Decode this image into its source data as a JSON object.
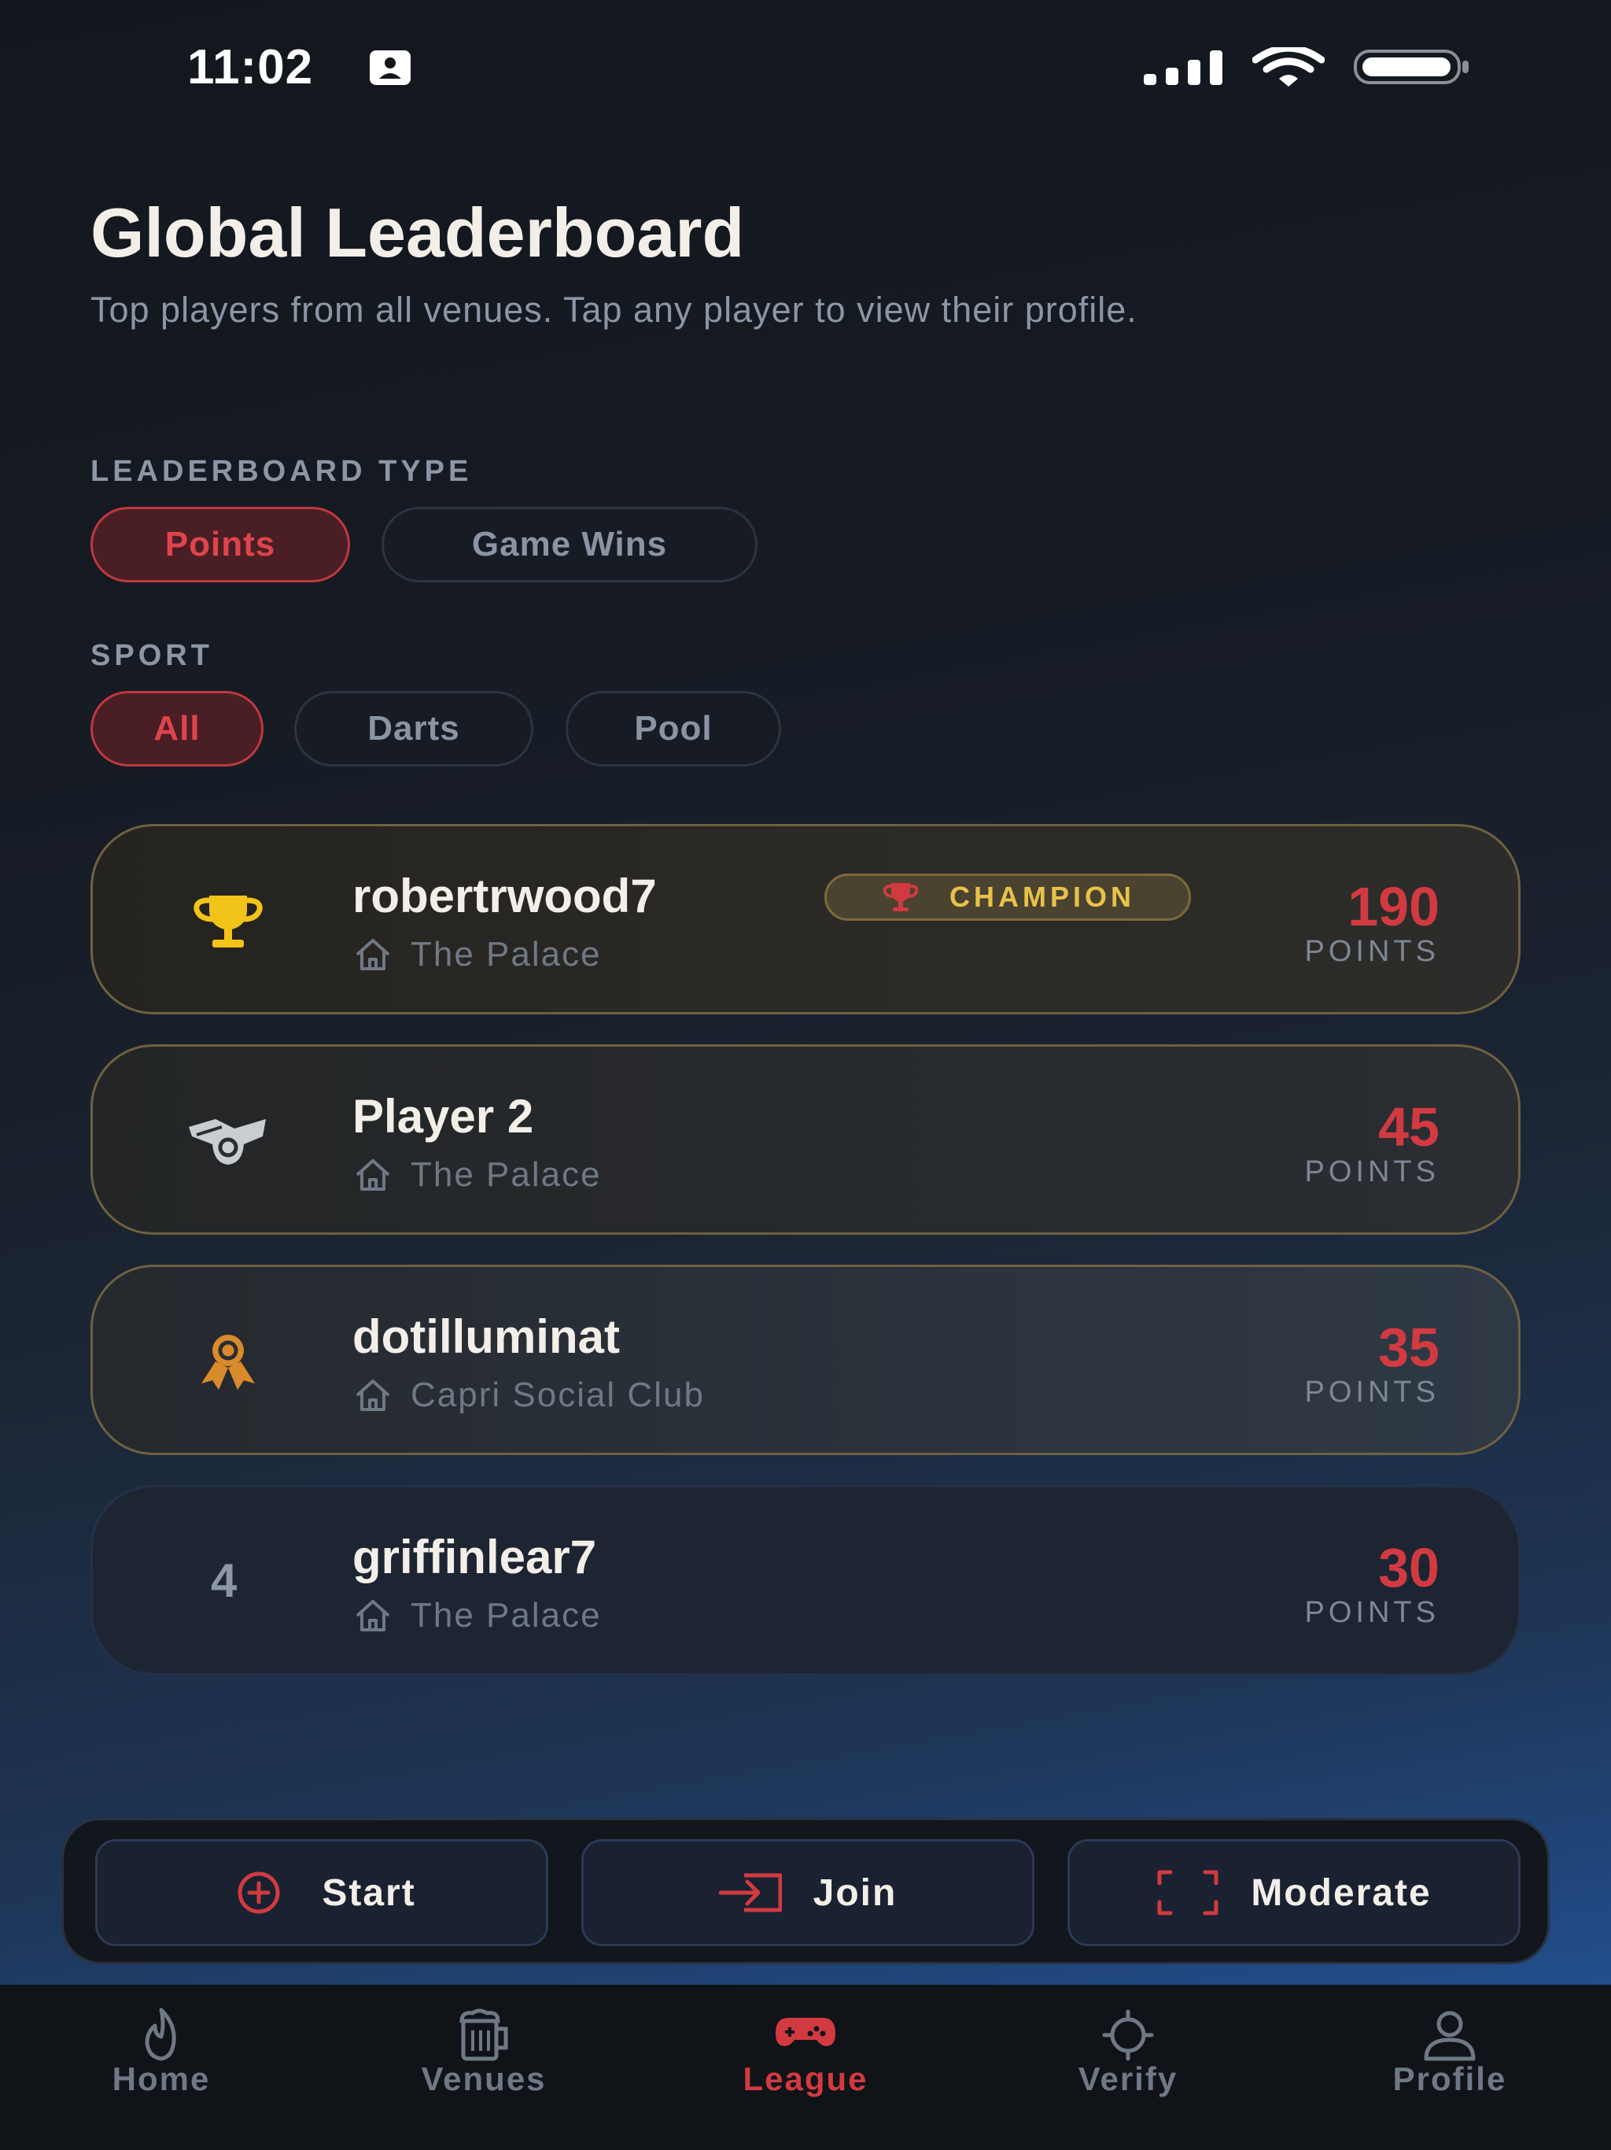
{
  "status_bar": {
    "time": "11:02"
  },
  "header": {
    "title": "Global Leaderboard",
    "subtitle": "Top players from all venues. Tap any player to view their profile."
  },
  "filters": {
    "type_label": "LEADERBOARD TYPE",
    "type_options": [
      "Points",
      "Game Wins"
    ],
    "type_selected": "Points",
    "sport_label": "SPORT",
    "sport_options": [
      "All",
      "Darts",
      "Pool"
    ],
    "sport_selected": "All"
  },
  "leaderboard": [
    {
      "rank": 1,
      "rank_icon": "gold-trophy-icon",
      "name": "robertrwood7",
      "badge": "CHAMPION",
      "venue": "The Palace",
      "points": "190",
      "points_label": "POINTS"
    },
    {
      "rank": 2,
      "rank_icon": "silver-medal-icon",
      "name": "Player 2",
      "venue": "The Palace",
      "points": "45",
      "points_label": "POINTS"
    },
    {
      "rank": 3,
      "rank_icon": "bronze-award-icon",
      "name": "dotilluminat",
      "venue": "Capri Social Club",
      "points": "35",
      "points_label": "POINTS"
    },
    {
      "rank": 4,
      "rank_text": "4",
      "name": "griffinlear7",
      "venue": "The Palace",
      "points": "30",
      "points_label": "POINTS"
    }
  ],
  "actions": [
    {
      "label": "Start",
      "icon": "plus-circle-icon"
    },
    {
      "label": "Join",
      "icon": "enter-icon"
    },
    {
      "label": "Moderate",
      "icon": "scan-frame-icon"
    }
  ],
  "tabs": [
    {
      "label": "Home",
      "icon": "flame-icon"
    },
    {
      "label": "Venues",
      "icon": "beer-mug-icon"
    },
    {
      "label": "League",
      "icon": "gamepad-icon",
      "active": true
    },
    {
      "label": "Verify",
      "icon": "crosshair-icon"
    },
    {
      "label": "Profile",
      "icon": "user-icon"
    }
  ],
  "colors": {
    "accent": "#d23a41",
    "gold": "#f2c318",
    "silver": "#c9ccd1",
    "bronze": "#d98a2b",
    "background_top": "#13171d",
    "background_bottom": "#2459a5"
  }
}
